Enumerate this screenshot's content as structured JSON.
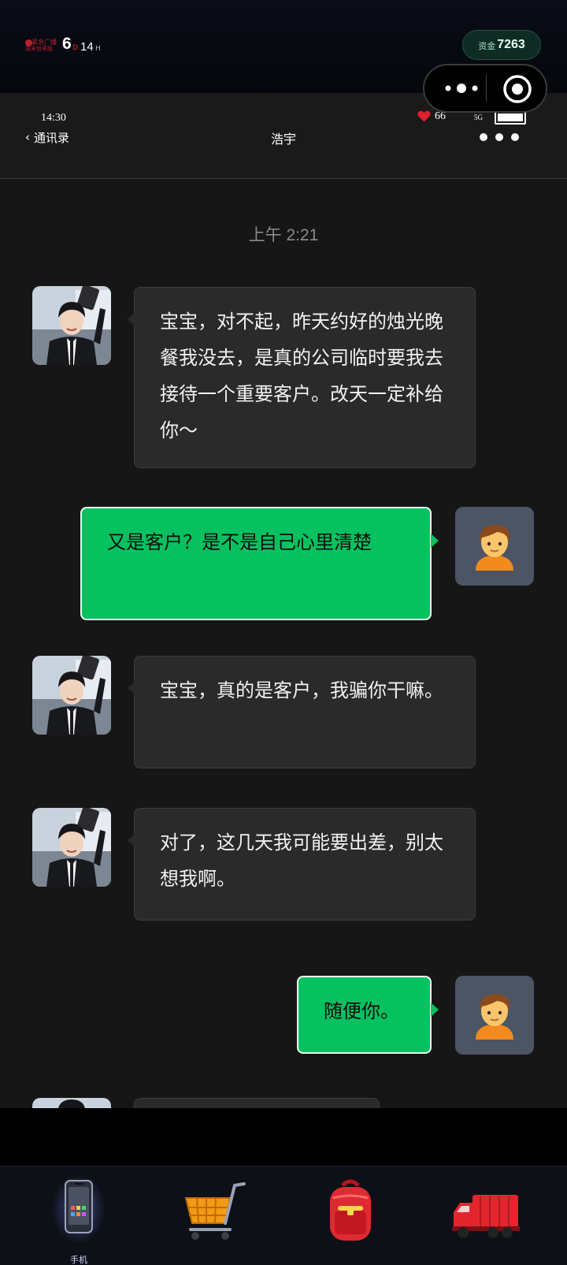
{
  "game": {
    "logo_line1": "紧急广播",
    "logo_line2": "周末世界版",
    "day_value": "6",
    "day_unit": "D",
    "hour_value": "14",
    "hour_unit": "H",
    "fund_label": "资金",
    "fund_value": "7263"
  },
  "status_bar": {
    "time": "14:30",
    "heart_count": "66",
    "signal": "5G"
  },
  "header": {
    "back_label": "通讯录",
    "contact_name": "浩宇"
  },
  "chat": {
    "timestamp": "上午 2:21",
    "messages": [
      {
        "sender": "contact",
        "text": "宝宝，对不起，昨天约好的烛光晚餐我没去，是真的公司临时要我去接待一个重要客户。改天一定补给你～"
      },
      {
        "sender": "self",
        "text": "又是客户？是不是自己心里清楚"
      },
      {
        "sender": "contact",
        "text": "宝宝，真的是客户，我骗你干嘛。"
      },
      {
        "sender": "contact",
        "text": "对了，这几天我可能要出差，别太想我啊。"
      },
      {
        "sender": "self",
        "text": "随便你。"
      }
    ]
  },
  "nav": {
    "items": [
      {
        "icon": "phone-icon",
        "label": "手机"
      },
      {
        "icon": "shopping-cart-icon",
        "label": ""
      },
      {
        "icon": "backpack-icon",
        "label": ""
      },
      {
        "icon": "truck-icon",
        "label": ""
      }
    ]
  },
  "colors": {
    "bubble_out": "#07c160",
    "bubble_in": "#2a2a2a",
    "background": "#161616",
    "fund_badge": "#0e2c24",
    "heart": "#e0202e"
  }
}
